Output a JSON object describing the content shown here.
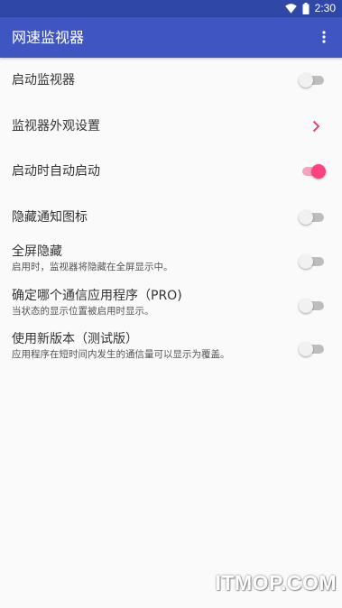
{
  "colors": {
    "status_bar": "#2f48a8",
    "app_bar": "#3f56c2",
    "accent": "#ff4081",
    "background": "#fafafa"
  },
  "status_bar": {
    "time": "2:30",
    "icons": [
      "wifi-icon",
      "battery-icon"
    ]
  },
  "app_bar": {
    "title": "网速监视器",
    "overflow_icon": "more-vert-icon"
  },
  "settings": [
    {
      "title": "启动监视器",
      "summary": "",
      "control": "switch",
      "checked": false
    },
    {
      "title": "监视器外观设置",
      "summary": "",
      "control": "chevron",
      "icon": "chevron-right-icon"
    },
    {
      "title": "启动时自动启动",
      "summary": "",
      "control": "switch",
      "checked": true
    },
    {
      "title": "隐藏通知图标",
      "summary": "",
      "control": "switch",
      "checked": false
    },
    {
      "title": "全屏隐藏",
      "summary": "启用时，监视器将隐藏在全屏显示中。",
      "control": "switch",
      "checked": false
    },
    {
      "title": "确定哪个通信应用程序（PRO)",
      "summary": "当状态的显示位置被启用时显示。",
      "control": "switch",
      "checked": false
    },
    {
      "title": "使用新版本（测试版）",
      "summary": "应用程序在短时间内发生的通信量可以显示为覆盖。",
      "control": "switch",
      "checked": false
    }
  ],
  "watermark": "ITMOP.COM"
}
